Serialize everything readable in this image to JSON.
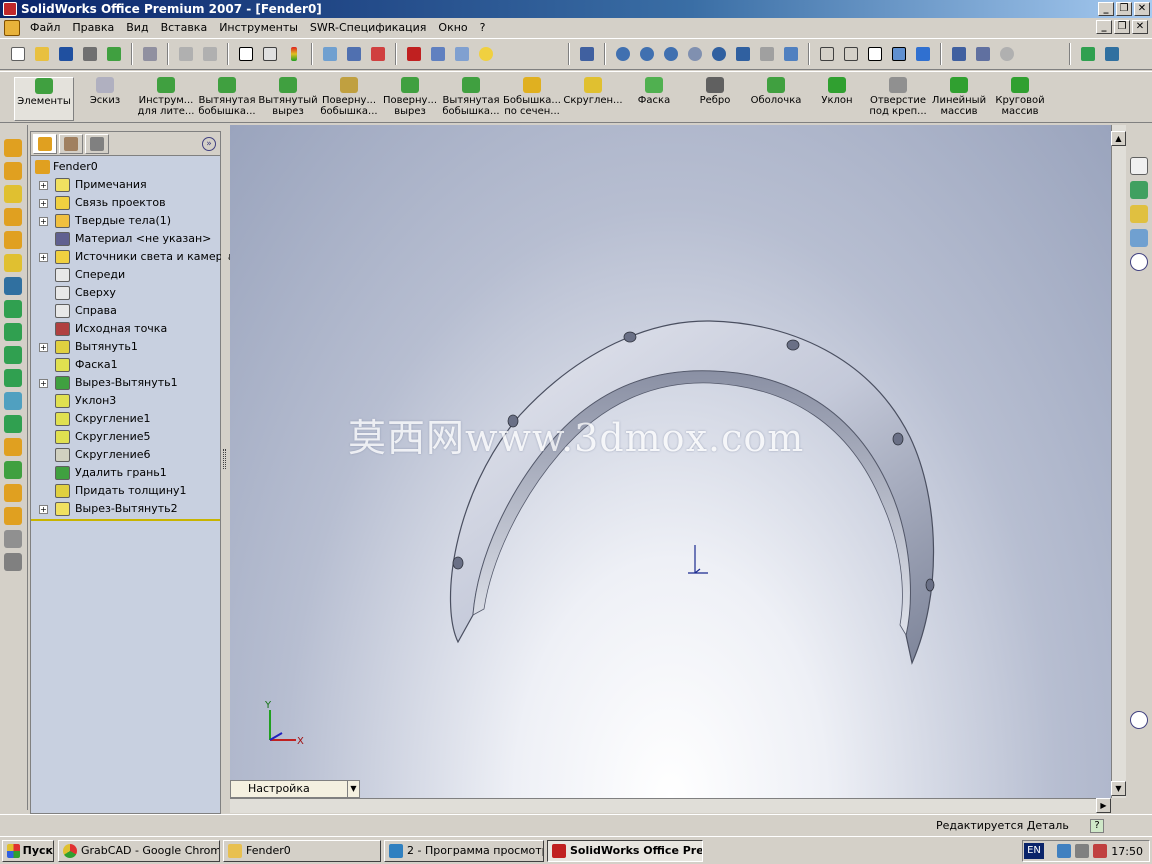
{
  "window": {
    "title": "SolidWorks Office Premium 2007 - [Fender0]"
  },
  "menu": [
    "Файл",
    "Правка",
    "Вид",
    "Вставка",
    "Инструменты",
    "SWR-Спецификация",
    "Окно",
    "?"
  ],
  "features_toolbar": [
    {
      "l1": "Элементы",
      "l2": ""
    },
    {
      "l1": "Эскиз",
      "l2": ""
    },
    {
      "l1": "Инструм...",
      "l2": "для лите..."
    },
    {
      "l1": "Вытянутая",
      "l2": "бобышка..."
    },
    {
      "l1": "Вытянутый",
      "l2": "вырез"
    },
    {
      "l1": "Поверну...",
      "l2": "бобышка..."
    },
    {
      "l1": "Поверну...",
      "l2": "вырез"
    },
    {
      "l1": "Вытянутая",
      "l2": "бобышка..."
    },
    {
      "l1": "Бобышка...",
      "l2": "по сечен..."
    },
    {
      "l1": "Скруглен...",
      "l2": ""
    },
    {
      "l1": "Фаска",
      "l2": ""
    },
    {
      "l1": "Ребро",
      "l2": ""
    },
    {
      "l1": "Оболочка",
      "l2": ""
    },
    {
      "l1": "Уклон",
      "l2": ""
    },
    {
      "l1": "Отверстие",
      "l2": "под креп..."
    },
    {
      "l1": "Линейный",
      "l2": "массив"
    },
    {
      "l1": "Круговой",
      "l2": "массив"
    }
  ],
  "tree": {
    "root": "Fender0",
    "items": [
      {
        "label": "Примечания",
        "expand": true
      },
      {
        "label": "Связь проектов",
        "expand": true
      },
      {
        "label": "Твердые тела(1)",
        "expand": true
      },
      {
        "label": "Материал <не указан>",
        "expand": false
      },
      {
        "label": "Источники света и камеры",
        "expand": true
      },
      {
        "label": "Спереди",
        "expand": false
      },
      {
        "label": "Сверху",
        "expand": false
      },
      {
        "label": "Справа",
        "expand": false
      },
      {
        "label": "Исходная точка",
        "expand": false
      },
      {
        "label": "Вытянуть1",
        "expand": true
      },
      {
        "label": "Фаска1",
        "expand": false
      },
      {
        "label": "Вырез-Вытянуть1",
        "expand": true
      },
      {
        "label": "Уклон3",
        "expand": false
      },
      {
        "label": "Скругление1",
        "expand": false
      },
      {
        "label": "Скругление5",
        "expand": false
      },
      {
        "label": "Скругление6",
        "expand": false
      },
      {
        "label": "Удалить грань1",
        "expand": false
      },
      {
        "label": "Придать толщину1",
        "expand": false
      },
      {
        "label": "Вырез-Вытянуть2",
        "expand": true
      }
    ]
  },
  "viewport": {
    "watermark": "莫西网www.3dmox.com",
    "triad_y": "Y",
    "triad_x": "X",
    "config_tab": "Настройка"
  },
  "status": {
    "text": "Редактируется Деталь",
    "help": "?"
  },
  "taskbar": {
    "start": "Пуск",
    "tasks": [
      "GrabCAD - Google Chrome",
      "Fender0",
      "2 - Программа просмотр...",
      "SolidWorks Office Pre..."
    ],
    "lang": "EN",
    "clock": "17:50"
  },
  "colors": {
    "title_bar": "#0a246a",
    "viewport_edge": "#9aa4bd",
    "part": "#c4c9d9",
    "rollback_bar": "#c8b400"
  }
}
